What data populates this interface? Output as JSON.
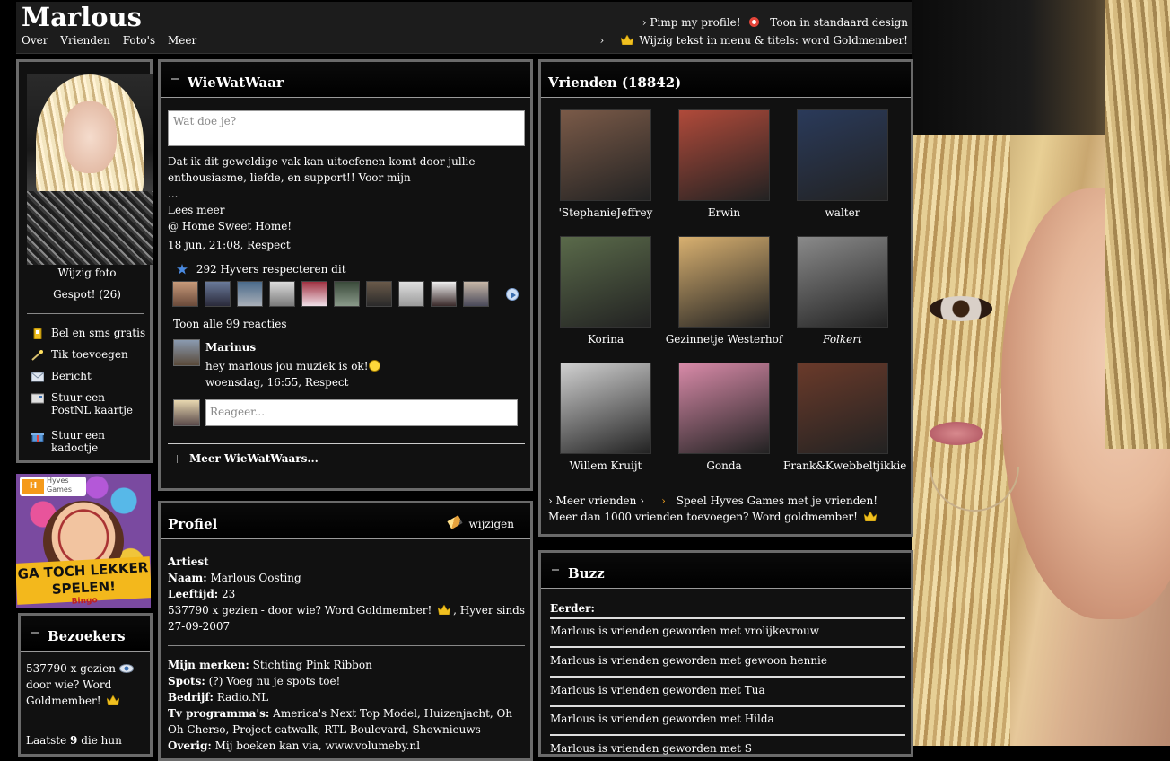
{
  "header": {
    "name": "Marlous",
    "nav": [
      "Over",
      "Vrienden",
      "Foto's",
      "Meer"
    ],
    "pimp": "Pimp my profile!",
    "standard_design": "Toon in standaard design",
    "goldmember_text": "Wijzig tekst in menu & titels: word Goldmember!"
  },
  "left": {
    "change_photo": "Wijzig foto",
    "spotted": "Gespot! (26)",
    "menu": [
      {
        "label": "Bel en sms gratis",
        "icon": "phone-icon"
      },
      {
        "label": "Tik toevoegen",
        "icon": "magic-wand-icon"
      },
      {
        "label": "Bericht",
        "icon": "envelope-icon"
      },
      {
        "label": "Stuur een PostNL kaartje",
        "icon": "postcard-icon"
      },
      {
        "label": "Stuur een kadootje",
        "icon": "gift-icon"
      }
    ]
  },
  "ad": {
    "brand": "Hyves",
    "brand_sub": "Games",
    "slogan": "GA TOCH LEKKER SPELEN!",
    "partner": "Bingo"
  },
  "bezoekers": {
    "title": "Bezoekers",
    "views": "537790 x gezien",
    "who": "- door wie? Word Goldmember!",
    "last_prefix": "Laatste",
    "last_count": "9",
    "last_suffix": "die hun"
  },
  "www": {
    "title": "WieWatWaar",
    "placeholder": "Wat doe je?",
    "post_text": "Dat ik dit geweldige vak kan uitoefenen komt door jullie enthousiasme, liefde, en support!! Voor mijn",
    "ellipsis": "...",
    "read_more": "Lees meer",
    "location": "@ Home Sweet Home!",
    "meta": "18 jun, 21:08, Respect",
    "respect_count": "292 Hyvers respecteren dit",
    "show_all": "Toon alle 99 reacties",
    "comment_author": "Marinus",
    "comment_text": "hey marlous jou muziek is ok!",
    "comment_meta": "woensdag, 16:55, Respect",
    "reply_placeholder": "Reageer...",
    "more": "Meer WieWatWaars..."
  },
  "profiel": {
    "title": "Profiel",
    "edit": "wijzigen",
    "type": "Artiest",
    "name_label": "Naam:",
    "name_value": "Marlous Oosting",
    "age_label": "Leeftijd:",
    "age_value": "23",
    "views_text": "537790 x gezien - door wie? Word Goldmember!",
    "since_text": ", Hyver sinds 27-09-2007",
    "brands_label": "Mijn merken:",
    "brands_value": "Stichting Pink Ribbon",
    "spots_label": "Spots:",
    "spots_value": "(?) Voeg nu je spots toe!",
    "company_label": "Bedrijf:",
    "company_value": "Radio.NL",
    "tv_label": "Tv programma's:",
    "tv_value": "America's Next Top Model, Huizenjacht, Oh Oh Cherso, Project catwalk, RTL Boulevard, Shownieuws",
    "other_label": "Overig:",
    "other_value": "Mij boeken kan via, www.volumeby.nl"
  },
  "vrienden": {
    "title": "Vrienden (18842)",
    "friends": [
      {
        "name": "'StephanieJeffrey",
        "color": "#7a5a48"
      },
      {
        "name": "Erwin",
        "color": "#b04a3a"
      },
      {
        "name": "walter",
        "color": "#2a3a5a"
      },
      {
        "name": "Korina",
        "color": "#5a6a4a"
      },
      {
        "name": "Gezinnetje Westerhof",
        "color": "#d8b070"
      },
      {
        "name": "Folkert",
        "color": "#8a8a8a"
      },
      {
        "name": "Willem Kruijt",
        "color": "#d0d0d0"
      },
      {
        "name": "Gonda",
        "color": "#d88aa8"
      },
      {
        "name": "Frank&Kwebbeltjikkie",
        "color": "#6a3a2a"
      }
    ],
    "more_friends": "Meer vrienden",
    "play_games": "Speel Hyves Games met je vrienden!",
    "goldmember": "Meer dan 1000 vrienden toevoegen? Word goldmember!"
  },
  "buzz": {
    "title": "Buzz",
    "earlier": "Eerder:",
    "items": [
      "Marlous is vrienden geworden met vrolijkevrouw",
      "Marlous is vrienden geworden met gewoon hennie",
      "Marlous is vrienden geworden met Tua",
      "Marlous is vrienden geworden met Hilda",
      "Marlous is vrienden geworden met S"
    ]
  },
  "colors": {
    "background": "#000000",
    "panel": "#111111",
    "panel_border": "#6a6a6a",
    "accent_blue": "#3b6fb0",
    "crown": "#f0c020"
  }
}
